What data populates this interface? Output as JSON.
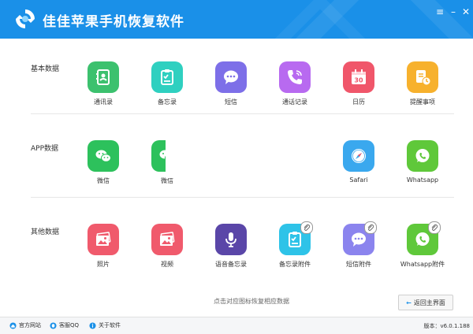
{
  "titlebar": {
    "title": "佳佳苹果手机恢复软件",
    "menu": "≡",
    "minimize": "–",
    "close": "✕"
  },
  "sections": {
    "basic": {
      "label": "基本数据"
    },
    "app": {
      "label": "APP数据"
    },
    "other": {
      "label": "其他数据"
    }
  },
  "tiles": {
    "contacts": "通讯录",
    "notes": "备忘录",
    "sms": "短信",
    "calls": "通话记录",
    "calendar": "日历",
    "reminders": "提醒事项",
    "wechat": "微信",
    "wechat2": "微信",
    "safari": "Safari",
    "whatsapp": "Whatsapp",
    "photos": "照片",
    "videos": "视频",
    "voice_memo": "语音备忘录",
    "notes_attach": "备忘录附件",
    "sms_attach": "短信附件",
    "whatsapp_attach": "Whatsapp附件"
  },
  "calendar_day": "30",
  "hint": "点击对应图标恢复相应数据",
  "back_button": "返回主界面",
  "statusbar": {
    "website": "官方网站",
    "qq": "客服QQ",
    "about": "关于软件",
    "version": "版本：v6.0.1.188"
  },
  "colors": {
    "title_bg": "#1a90e8",
    "contacts": "#3cc16e",
    "notes": "#2fd0c0",
    "sms": "#7d6fe8",
    "calls": "#b86af0",
    "calendar": "#f0566a",
    "reminders": "#f7b12d",
    "wechat": "#2dc15c",
    "safari": "#3aa8ee",
    "whatsapp": "#5fc83a",
    "photos": "#f05a6c",
    "voice_memo": "#5a46a8",
    "notes_attach": "#2ec3e8",
    "sms_attach": "#8b84ee"
  }
}
